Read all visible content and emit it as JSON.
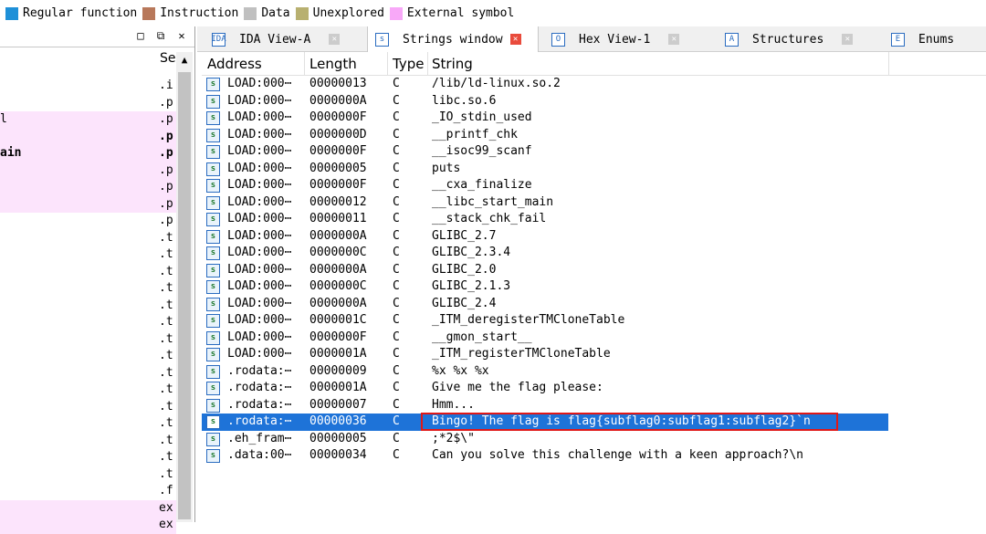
{
  "legend": [
    {
      "label": "Regular function",
      "color": "#1e90d8"
    },
    {
      "label": "Instruction",
      "color": "#b8785a"
    },
    {
      "label": "Data",
      "color": "#c0c0c0"
    },
    {
      "label": "Unexplored",
      "color": "#b8b070"
    },
    {
      "label": "External symbol",
      "color": "#f8a8f8"
    }
  ],
  "left_pane": {
    "header_seg": "Se",
    "rows": [
      {
        "name": "",
        "seg": ".i",
        "pink": false,
        "bold": false
      },
      {
        "name": "",
        "seg": ".p",
        "pink": false,
        "bold": false
      },
      {
        "name": "l",
        "seg": ".p",
        "pink": true,
        "bold": false
      },
      {
        "name": "",
        "seg": ".p",
        "pink": true,
        "bold": true
      },
      {
        "name": "ain",
        "seg": ".p",
        "pink": true,
        "bold": true
      },
      {
        "name": "",
        "seg": ".p",
        "pink": true,
        "bold": false
      },
      {
        "name": "",
        "seg": ".p",
        "pink": true,
        "bold": false
      },
      {
        "name": "",
        "seg": ".p",
        "pink": true,
        "bold": false
      },
      {
        "name": "",
        "seg": ".p",
        "pink": false,
        "bold": false
      },
      {
        "name": "",
        "seg": ".t",
        "pink": false,
        "bold": false
      },
      {
        "name": "",
        "seg": ".t",
        "pink": false,
        "bold": false
      },
      {
        "name": "",
        "seg": ".t",
        "pink": false,
        "bold": false
      },
      {
        "name": "",
        "seg": ".t",
        "pink": false,
        "bold": false
      },
      {
        "name": "",
        "seg": ".t",
        "pink": false,
        "bold": false
      },
      {
        "name": "",
        "seg": ".t",
        "pink": false,
        "bold": false
      },
      {
        "name": "",
        "seg": ".t",
        "pink": false,
        "bold": false
      },
      {
        "name": "",
        "seg": ".t",
        "pink": false,
        "bold": false
      },
      {
        "name": "",
        "seg": ".t",
        "pink": false,
        "bold": false
      },
      {
        "name": "",
        "seg": ".t",
        "pink": false,
        "bold": false
      },
      {
        "name": "",
        "seg": ".t",
        "pink": false,
        "bold": false
      },
      {
        "name": "",
        "seg": ".t",
        "pink": false,
        "bold": false
      },
      {
        "name": "",
        "seg": ".t",
        "pink": false,
        "bold": false
      },
      {
        "name": "",
        "seg": ".t",
        "pink": false,
        "bold": false
      },
      {
        "name": "",
        "seg": ".t",
        "pink": false,
        "bold": false
      },
      {
        "name": "",
        "seg": ".f",
        "pink": false,
        "bold": false
      },
      {
        "name": "",
        "seg": "ex",
        "pink": true,
        "bold": false
      },
      {
        "name": "",
        "seg": "ex",
        "pink": true,
        "bold": false
      }
    ]
  },
  "tabs": [
    {
      "label": "IDA View-A",
      "icon": "IDA",
      "active": false
    },
    {
      "label": "Strings window",
      "icon": "s",
      "active": true
    },
    {
      "label": "Hex View-1",
      "icon": "O",
      "active": false
    },
    {
      "label": "Structures",
      "icon": "A",
      "active": false
    },
    {
      "label": "Enums",
      "icon": "E",
      "active": false
    }
  ],
  "grid": {
    "columns": [
      "Address",
      "Length",
      "Type",
      "String"
    ],
    "rows": [
      [
        "LOAD:000⋯",
        "00000013",
        "C",
        "/lib/ld-linux.so.2"
      ],
      [
        "LOAD:000⋯",
        "0000000A",
        "C",
        "libc.so.6"
      ],
      [
        "LOAD:000⋯",
        "0000000F",
        "C",
        "_IO_stdin_used"
      ],
      [
        "LOAD:000⋯",
        "0000000D",
        "C",
        "__printf_chk"
      ],
      [
        "LOAD:000⋯",
        "0000000F",
        "C",
        "__isoc99_scanf"
      ],
      [
        "LOAD:000⋯",
        "00000005",
        "C",
        "puts"
      ],
      [
        "LOAD:000⋯",
        "0000000F",
        "C",
        "__cxa_finalize"
      ],
      [
        "LOAD:000⋯",
        "00000012",
        "C",
        "__libc_start_main"
      ],
      [
        "LOAD:000⋯",
        "00000011",
        "C",
        "__stack_chk_fail"
      ],
      [
        "LOAD:000⋯",
        "0000000A",
        "C",
        "GLIBC_2.7"
      ],
      [
        "LOAD:000⋯",
        "0000000C",
        "C",
        "GLIBC_2.3.4"
      ],
      [
        "LOAD:000⋯",
        "0000000A",
        "C",
        "GLIBC_2.0"
      ],
      [
        "LOAD:000⋯",
        "0000000C",
        "C",
        "GLIBC_2.1.3"
      ],
      [
        "LOAD:000⋯",
        "0000000A",
        "C",
        "GLIBC_2.4"
      ],
      [
        "LOAD:000⋯",
        "0000001C",
        "C",
        "_ITM_deregisterTMCloneTable"
      ],
      [
        "LOAD:000⋯",
        "0000000F",
        "C",
        "__gmon_start__"
      ],
      [
        "LOAD:000⋯",
        "0000001A",
        "C",
        "_ITM_registerTMCloneTable"
      ],
      [
        ".rodata:⋯",
        "00000009",
        "C",
        "%x %x %x"
      ],
      [
        ".rodata:⋯",
        "0000001A",
        "C",
        "Give me the flag please:"
      ],
      [
        ".rodata:⋯",
        "00000007",
        "C",
        "Hmm..."
      ],
      [
        ".rodata:⋯",
        "00000036",
        "C",
        "Bingo! The flag is flag{subflag0:subflag1:subflag2}`n"
      ],
      [
        ".eh_fram⋯",
        "00000005",
        "C",
        ";*2$\\\""
      ],
      [
        ".data:00⋯",
        "00000034",
        "C",
        "Can you solve this challenge with a keen approach?\\n"
      ]
    ],
    "selected_index": 20
  }
}
